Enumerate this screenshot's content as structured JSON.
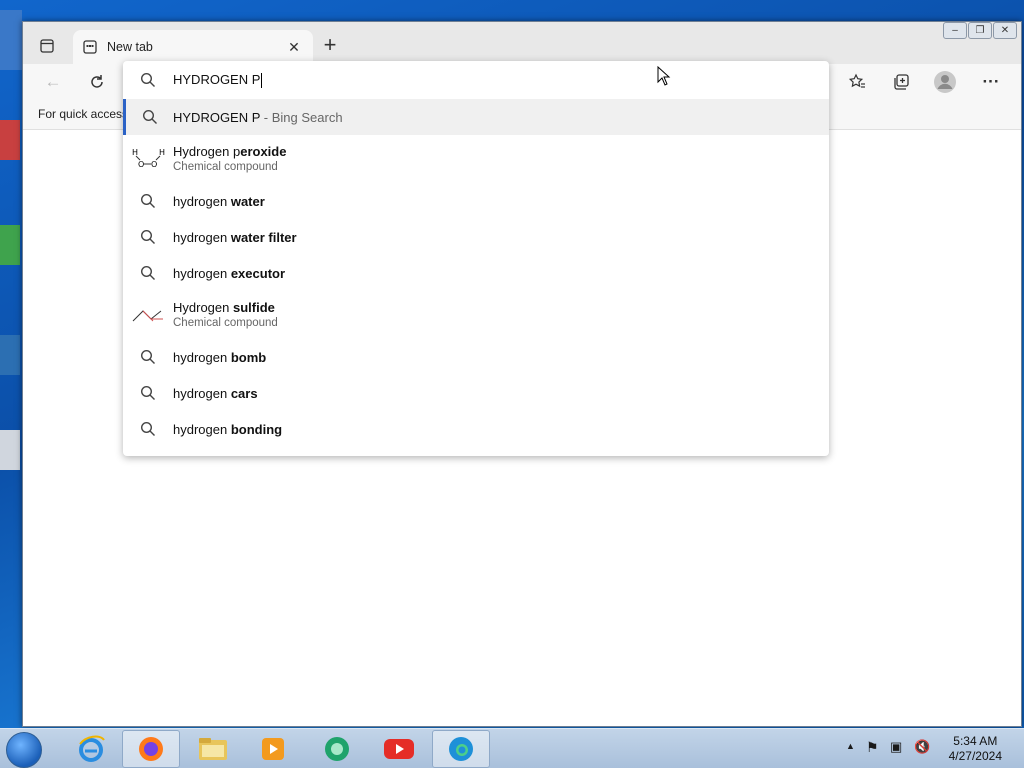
{
  "tab": {
    "title": "New tab",
    "close": "✕"
  },
  "favbar": {
    "label": "For quick access"
  },
  "omnibox": {
    "value": "HYDROGEN P"
  },
  "suggestions": [
    {
      "text": "HYDROGEN P",
      "suffix": "- Bing Search",
      "icon": "search-icon"
    },
    {
      "normal": "Hydrogen p",
      "bold": "eroxide",
      "sub": "Chemical compound",
      "icon": "molecule-icon"
    },
    {
      "normal": "hydrogen ",
      "bold": "water",
      "icon": "search-icon"
    },
    {
      "normal": "hydrogen ",
      "bold": "water filter",
      "icon": "search-icon"
    },
    {
      "normal": "hydrogen ",
      "bold": "executor",
      "icon": "search-icon"
    },
    {
      "normal": "Hydrogen ",
      "bold": "sulfide",
      "sub": "Chemical compound",
      "icon": "molecule-icon"
    },
    {
      "normal": "hydrogen ",
      "bold": "bomb",
      "icon": "search-icon"
    },
    {
      "normal": "hydrogen ",
      "bold": "cars",
      "icon": "search-icon"
    },
    {
      "normal": "hydrogen ",
      "bold": "bonding",
      "icon": "search-icon"
    }
  ],
  "clock": {
    "time": "5:34 AM",
    "date": "4/27/2024"
  },
  "colors": {
    "accent": "#2b62c6",
    "taskbar": "#b4c8e0"
  }
}
